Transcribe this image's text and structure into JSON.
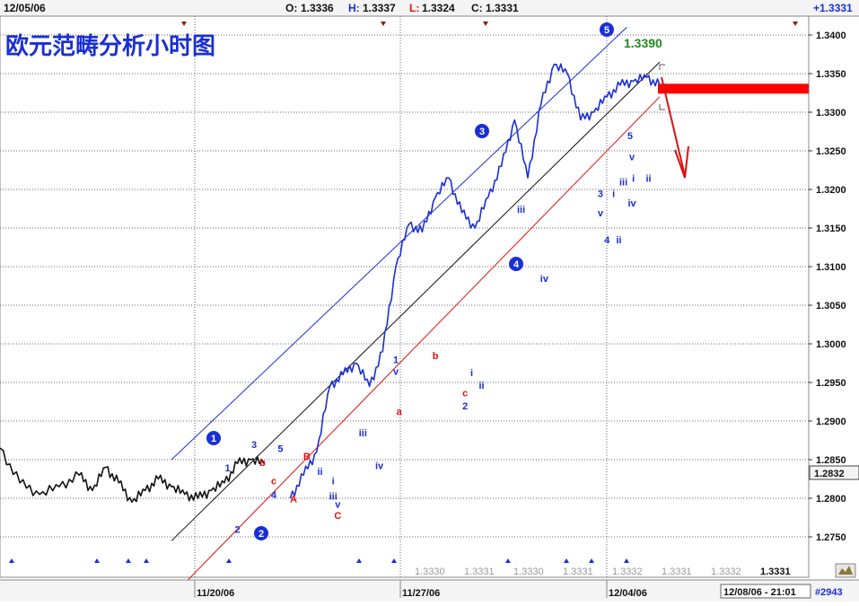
{
  "header": {
    "date": "12/05/06",
    "open_label": "O:",
    "open_value": "1.3336",
    "high_label": "H:",
    "high_value": "1.3337",
    "low_label": "L:",
    "low_value": "1.3324",
    "close_label": "C:",
    "close_value": "1.3331",
    "change": "+1.3331"
  },
  "title": "欧元范畴分析小时图",
  "target_label": "1.3390",
  "footer": {
    "dates": [
      "11/20/06",
      "11/27/06",
      "12/04/06"
    ],
    "timestamp": "12/08/06 - 21:01",
    "bar_count": "#2943"
  },
  "price_tag": "1.2832",
  "bottom_values": [
    "1.3330",
    "1.3331",
    "1.3330",
    "1.3331",
    "1.3332",
    "1.3331",
    "1.3332",
    "1.3331"
  ],
  "colors": {
    "up": "#1a2fd6",
    "down": "#e01010",
    "neutral": "#111111",
    "grid": "#6a6a6a",
    "channel_upper": "#1a2fd6",
    "channel_mid": "#111111",
    "channel_lower": "#e01010",
    "wave_blue": "#1a2fd6",
    "wave_red": "#e01010",
    "target_green": "#1f8a1f",
    "triangle_marker": "#1a2fd6",
    "dark_marker": "#8b1a0a"
  },
  "chart_data": {
    "type": "line",
    "title": "欧元范畴分析小时图",
    "instrument_ohlc": {
      "open": 1.3336,
      "high": 1.3337,
      "low": 1.3324,
      "close": 1.3331
    },
    "ylim": [
      1.271,
      1.342
    ],
    "y_ticks": [
      1.34,
      1.335,
      1.33,
      1.325,
      1.32,
      1.315,
      1.31,
      1.305,
      1.3,
      1.295,
      1.29,
      1.285,
      1.28,
      1.275
    ],
    "x_ticks": [
      "11/20/06",
      "11/27/06",
      "12/04/06"
    ],
    "grid": true,
    "x_index_range": [
      0,
      100
    ],
    "series": [
      {
        "color": "#111111",
        "x": [
          0,
          3,
          6,
          9,
          12,
          14,
          16,
          18,
          20,
          22,
          24,
          26,
          28,
          30,
          32,
          34,
          36,
          38,
          40
        ],
        "y": [
          1.2865,
          1.282,
          1.2805,
          1.2815,
          1.283,
          1.281,
          1.284,
          1.282,
          1.2795,
          1.281,
          1.2825,
          1.2815,
          1.2805,
          1.28,
          1.281,
          1.282,
          1.2845,
          1.285,
          1.2845
        ]
      },
      {
        "color": "#1a2fd6",
        "x": [
          44,
          46,
          48,
          50,
          52,
          54,
          56,
          58,
          60,
          62,
          64,
          66,
          68,
          70,
          72,
          74,
          76,
          78,
          80,
          82,
          84,
          86,
          88,
          90,
          92,
          94,
          96,
          98,
          100
        ],
        "y": [
          1.28,
          1.283,
          1.286,
          1.2945,
          1.296,
          1.2975,
          1.2945,
          1.299,
          1.31,
          1.3155,
          1.3145,
          1.319,
          1.3215,
          1.317,
          1.315,
          1.319,
          1.323,
          1.329,
          1.3215,
          1.331,
          1.3362,
          1.335,
          1.329,
          1.33,
          1.332,
          1.3335,
          1.334,
          1.3345,
          1.3335
        ]
      }
    ],
    "channels": [
      {
        "name": "upper",
        "color": "#1a2fd6",
        "from": [
          26,
          1.285
        ],
        "to": [
          95,
          1.341
        ]
      },
      {
        "name": "mid",
        "color": "#111111",
        "from": [
          26,
          1.2745
        ],
        "to": [
          100,
          1.3365
        ]
      },
      {
        "name": "lower",
        "color": "#e01010",
        "from": [
          28,
          1.269
        ],
        "to": [
          100,
          1.332
        ]
      }
    ],
    "resistance_level": 1.3331,
    "target": 1.339,
    "wave_labels": [
      {
        "text": "1",
        "x": 34.5,
        "y": 1.2835,
        "color": "blue"
      },
      {
        "text": "2",
        "x": 36.0,
        "y": 1.2755,
        "color": "blue"
      },
      {
        "text": "3",
        "x": 38.5,
        "y": 1.2865,
        "color": "blue"
      },
      {
        "text": "b",
        "x": 39.8,
        "y": 1.2842,
        "color": "red"
      },
      {
        "text": "c",
        "x": 41.5,
        "y": 1.2818,
        "color": "red"
      },
      {
        "text": "4",
        "x": 41.5,
        "y": 1.28,
        "color": "blue"
      },
      {
        "text": "5",
        "x": 42.5,
        "y": 1.286,
        "color": "blue"
      },
      {
        "text": "1",
        "x": 42.5,
        "y": 1.288,
        "color": "blue",
        "circled": true
      },
      {
        "text": "A",
        "x": 44.5,
        "y": 1.2795,
        "color": "red"
      },
      {
        "text": "B",
        "x": 46.5,
        "y": 1.285,
        "color": "red"
      },
      {
        "text": "ii",
        "x": 48.5,
        "y": 1.283,
        "color": "blue"
      },
      {
        "text": "i",
        "x": 50.5,
        "y": 1.2818,
        "color": "blue"
      },
      {
        "text": "iii",
        "x": 50.5,
        "y": 1.2798,
        "color": "blue"
      },
      {
        "text": "v",
        "x": 51.2,
        "y": 1.2788,
        "color": "blue"
      },
      {
        "text": "C",
        "x": 51.2,
        "y": 1.2773,
        "color": "red"
      },
      {
        "text": "2",
        "x": 51.5,
        "y": 1.2745,
        "color": "blue",
        "circled": true
      },
      {
        "text": "iii",
        "x": 55.0,
        "y": 1.288,
        "color": "blue"
      },
      {
        "text": "iv",
        "x": 57.5,
        "y": 1.2838,
        "color": "blue"
      },
      {
        "text": "a",
        "x": 60.5,
        "y": 1.2908,
        "color": "red"
      },
      {
        "text": "1",
        "x": 60.0,
        "y": 1.2975,
        "color": "blue"
      },
      {
        "text": "v",
        "x": 60.0,
        "y": 1.296,
        "color": "blue"
      },
      {
        "text": "b",
        "x": 66.0,
        "y": 1.298,
        "color": "red"
      },
      {
        "text": "c",
        "x": 70.5,
        "y": 1.2932,
        "color": "red"
      },
      {
        "text": "2",
        "x": 70.5,
        "y": 1.2915,
        "color": "blue"
      },
      {
        "text": "i",
        "x": 71.5,
        "y": 1.2958,
        "color": "blue"
      },
      {
        "text": "ii",
        "x": 73.0,
        "y": 1.2942,
        "color": "blue"
      },
      {
        "text": "iii",
        "x": 79.0,
        "y": 1.317,
        "color": "blue"
      },
      {
        "text": "iv",
        "x": 82.5,
        "y": 1.308,
        "color": "blue"
      },
      {
        "text": "3",
        "x": 91.0,
        "y": 1.319,
        "color": "blue"
      },
      {
        "text": "i",
        "x": 93.0,
        "y": 1.319,
        "color": "blue"
      },
      {
        "text": "v",
        "x": 91.0,
        "y": 1.3165,
        "color": "blue"
      },
      {
        "text": "4",
        "x": 92.0,
        "y": 1.313,
        "color": "blue"
      },
      {
        "text": "ii",
        "x": 93.8,
        "y": 1.313,
        "color": "blue"
      },
      {
        "text": "iii",
        "x": 94.5,
        "y": 1.3205,
        "color": "blue"
      },
      {
        "text": "i",
        "x": 96.0,
        "y": 1.321,
        "color": "blue"
      },
      {
        "text": "iv",
        "x": 95.8,
        "y": 1.3178,
        "color": "blue"
      },
      {
        "text": "v",
        "x": 95.8,
        "y": 1.3238,
        "color": "blue"
      },
      {
        "text": "ii",
        "x": 98.3,
        "y": 1.321,
        "color": "blue"
      },
      {
        "text": "3",
        "x": 95.5,
        "y": 1.329,
        "color": "blue",
        "circled": true
      },
      {
        "text": "5",
        "x": 95.5,
        "y": 1.3265,
        "color": "blue"
      }
    ]
  }
}
